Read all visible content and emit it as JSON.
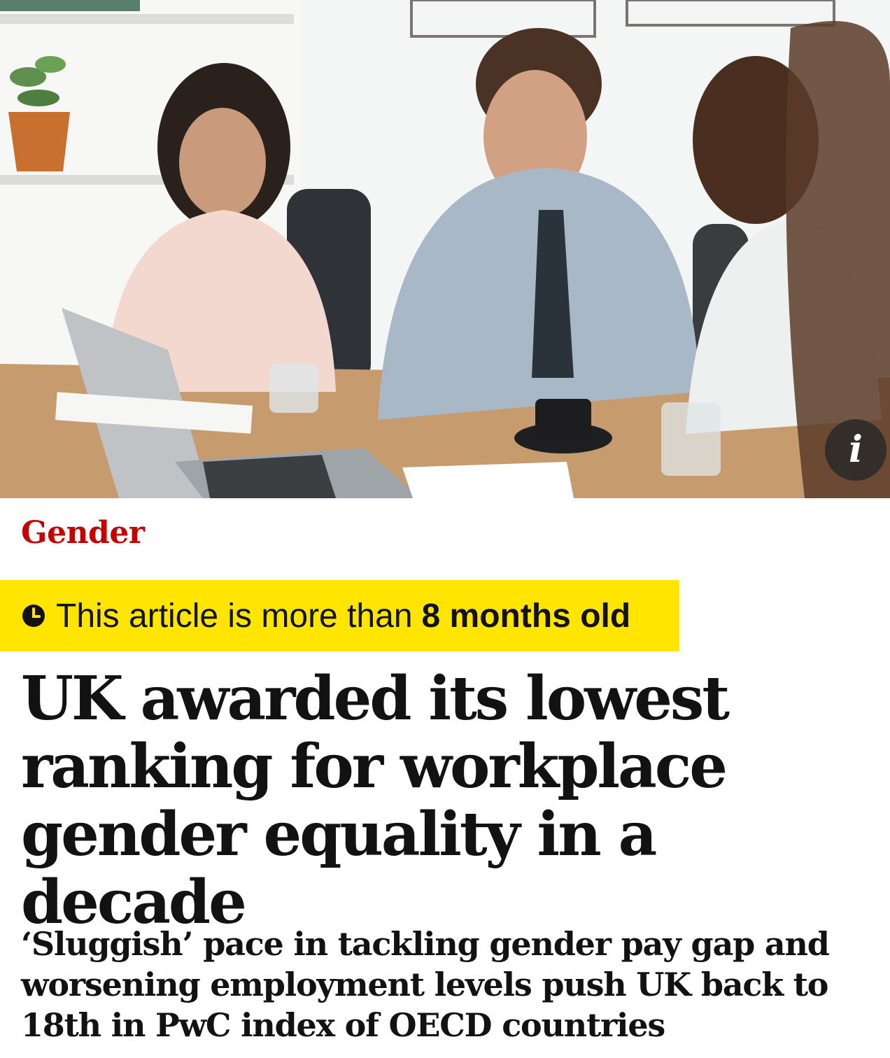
{
  "article": {
    "section": "Gender",
    "age_warning_prefix": "This article is more than",
    "age_warning_bold": "8 months old",
    "headline": "UK awarded its lowest ranking for workplace gender equality in a decade",
    "standfirst": "‘Sluggish’ pace in tackling gender pay gap and worsening employment levels push UK back to 18th in PwC index of OECD countries"
  },
  "image": {
    "info_button_label": "i",
    "description_icon": "photo-of-four-colleagues-at-laptop"
  },
  "colors": {
    "section": "#c70000",
    "age_warning_bg": "#ffe500",
    "text": "#121212"
  },
  "icons": {
    "age_warning": "clock-icon",
    "image_info": "info-icon"
  }
}
